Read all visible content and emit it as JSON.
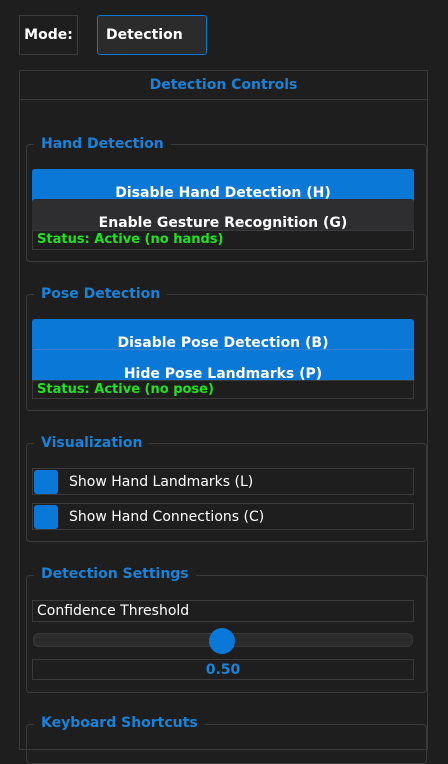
{
  "mode": {
    "label": "Mode:",
    "value": "Detection"
  },
  "panel": {
    "title": "Detection Controls"
  },
  "hand": {
    "title": "Hand Detection",
    "toggle_button": "Disable Hand Detection (H)",
    "gesture_button": "Enable Gesture Recognition (G)",
    "status": "Status: Active (no hands)"
  },
  "pose": {
    "title": "Pose Detection",
    "toggle_button": "Disable Pose Detection (B)",
    "landmarks_button": "Hide Pose Landmarks (P)",
    "status": "Status: Active (no pose)"
  },
  "visualization": {
    "title": "Visualization",
    "show_landmarks": "Show Hand Landmarks (L)",
    "show_connections": "Show Hand Connections (C)"
  },
  "settings": {
    "title": "Detection Settings",
    "threshold_label": "Confidence Threshold",
    "threshold_value": 0.5,
    "threshold_display": "0.50"
  },
  "shortcuts": {
    "title": "Keyboard Shortcuts"
  },
  "colors": {
    "accent": "#0a78d7",
    "status_ok": "#22e022",
    "background": "#1e1e1e"
  }
}
